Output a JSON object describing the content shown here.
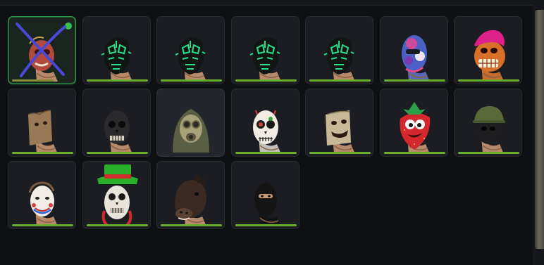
{
  "items": [
    {
      "mask": "red-face-crossed-mask",
      "wear": 0.68,
      "wear_color": "#8a8b3a",
      "selected": true,
      "crossed": true
    },
    {
      "mask": "neon-green-tech-mask",
      "wear": 1.0,
      "wear_color": "#6cae2e"
    },
    {
      "mask": "neon-green-tech-mask",
      "wear": 1.0,
      "wear_color": "#6cae2e"
    },
    {
      "mask": "neon-green-tech-mask",
      "wear": 1.0,
      "wear_color": "#6cae2e"
    },
    {
      "mask": "neon-green-tech-mask",
      "wear": 1.0,
      "wear_color": "#6cae2e"
    },
    {
      "mask": "tie-dye-balaclava-mask",
      "wear": 1.0,
      "wear_color": "#6cae2e"
    },
    {
      "mask": "pink-hair-zombie-mask",
      "wear": 1.0,
      "wear_color": "#6cae2e"
    },
    {
      "mask": "paper-bag-mask",
      "wear": 1.0,
      "wear_color": "#6cae2e"
    },
    {
      "mask": "black-skull-mask",
      "wear": 1.0,
      "wear_color": "#6cae2e"
    },
    {
      "mask": "gas-mask-hood",
      "wear": 0.0,
      "wear_color": "#6cae2e",
      "hover": true
    },
    {
      "mask": "sugar-skull-mask",
      "wear": 1.0,
      "wear_color": "#6cae2e"
    },
    {
      "mask": "sack-grin-mask",
      "wear": 1.0,
      "wear_color": "#6cae2e"
    },
    {
      "mask": "strawberry-mask",
      "wear": 1.0,
      "wear_color": "#6cae2e"
    },
    {
      "mask": "soldier-helmet-mask",
      "wear": 1.0,
      "wear_color": "#6cae2e"
    },
    {
      "mask": "clown-face-mask",
      "wear": 1.0,
      "wear_color": "#6cae2e"
    },
    {
      "mask": "leprechaun-skull-mask",
      "wear": 1.0,
      "wear_color": "#6cae2e"
    },
    {
      "mask": "horse-head-mask",
      "wear": 1.0,
      "wear_color": "#6cae2e"
    },
    {
      "mask": "black-balaclava-mask",
      "wear": 1.0,
      "wear_color": "#6cae2e"
    }
  ],
  "colors": {
    "card_bg": "#1b1d22",
    "card_border": "#272a30",
    "selected_border": "#2f9a4c",
    "page_bg": "#0f1013",
    "cross": "#4a49d6"
  }
}
